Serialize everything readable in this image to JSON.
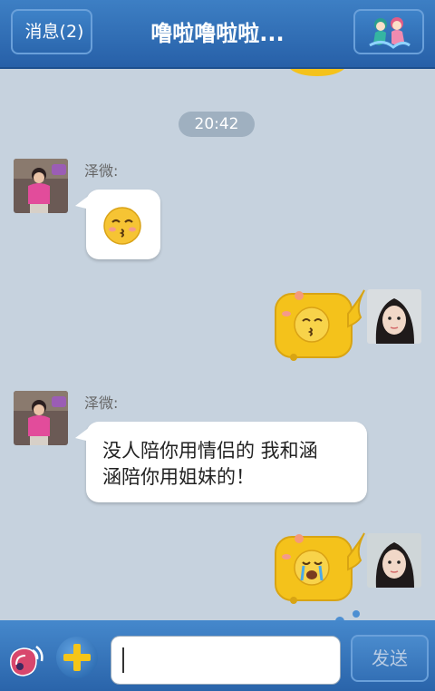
{
  "header": {
    "back_label": "消息(2)",
    "title": "噜啦噜啦啦...",
    "profile_icon": "mermaid-avatar-icon"
  },
  "chat": {
    "timestamp": "20:42",
    "messages": [
      {
        "side": "left",
        "sender": "泽微:",
        "type": "emoji",
        "icon": "kiss-face-emoji-icon"
      },
      {
        "side": "right",
        "type": "sticker",
        "icon": "yellow-whale-kiss-sticker-icon"
      },
      {
        "side": "left",
        "sender": "泽微:",
        "type": "text",
        "text_line1": "没人陪你用情侣的 我和涵",
        "text_line2": "涵陪你用姐妹的！"
      },
      {
        "side": "right",
        "type": "sticker",
        "icon": "yellow-whale-crying-sticker-icon"
      }
    ]
  },
  "composer": {
    "input_value": "",
    "send_label": "发送",
    "voice_icon": "conch-voice-icon",
    "plus_icon": "plus-icon"
  },
  "colors": {
    "bar_blue": "#2f6db3",
    "chat_background": "#c6d2de",
    "sticker_yellow": "#f4c21b"
  }
}
